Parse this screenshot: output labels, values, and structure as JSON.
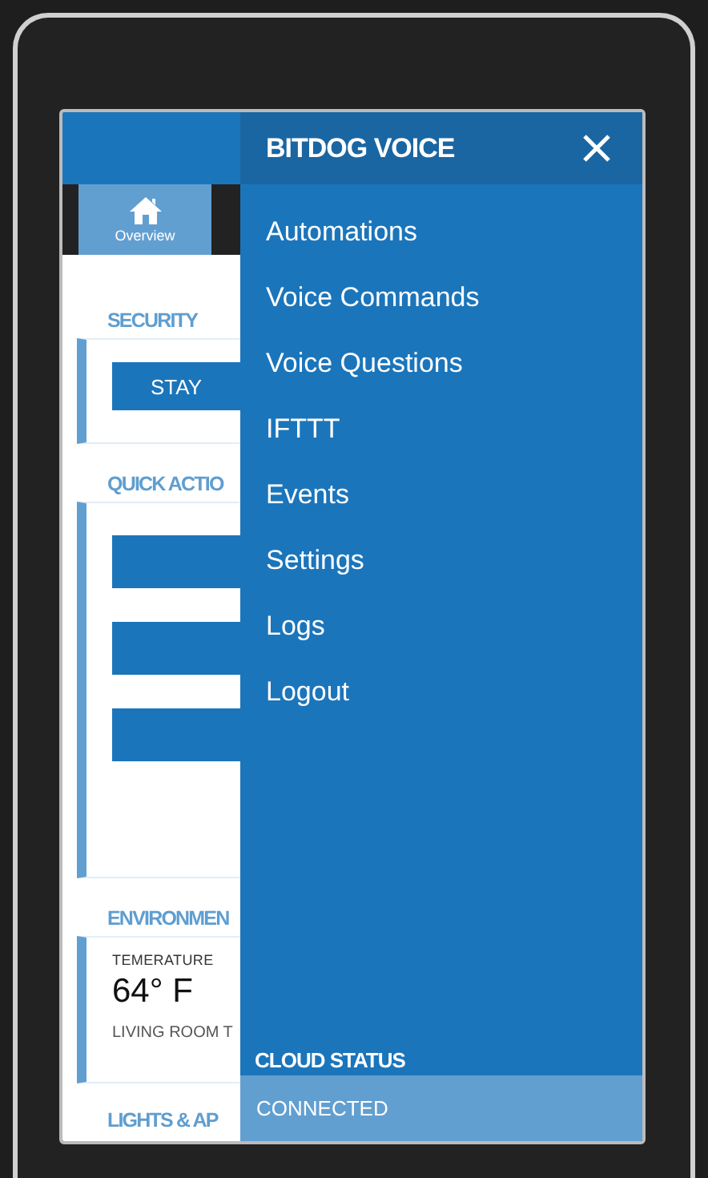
{
  "nav_tabs": [
    {
      "label": "Overview",
      "selected": true
    }
  ],
  "sections": [
    {
      "kind": "security",
      "title": "SECURITY",
      "buttons": [
        "STAY"
      ]
    },
    {
      "kind": "actions",
      "title": "QUICK ACTIO",
      "buttons": [
        {
          "kind": "blank"
        },
        {
          "kind": "blank"
        },
        {
          "kind": "blank"
        }
      ]
    },
    {
      "kind": "environment",
      "title": "ENVIRONMEN",
      "label": "TEMERATURE",
      "value": "64° F",
      "sublabel": "LIVING ROOM T"
    },
    {
      "kind": "heading",
      "title": "LIGHTS & AP"
    }
  ],
  "drawer": {
    "title": "BITDOG VOICE",
    "items": [
      "Automations",
      "Voice Commands",
      "Voice Questions",
      "IFTTT",
      "Events",
      "Settings",
      "Logs",
      "Logout"
    ],
    "status_title": "CLOUD STATUS",
    "status": "CONNECTED"
  }
}
